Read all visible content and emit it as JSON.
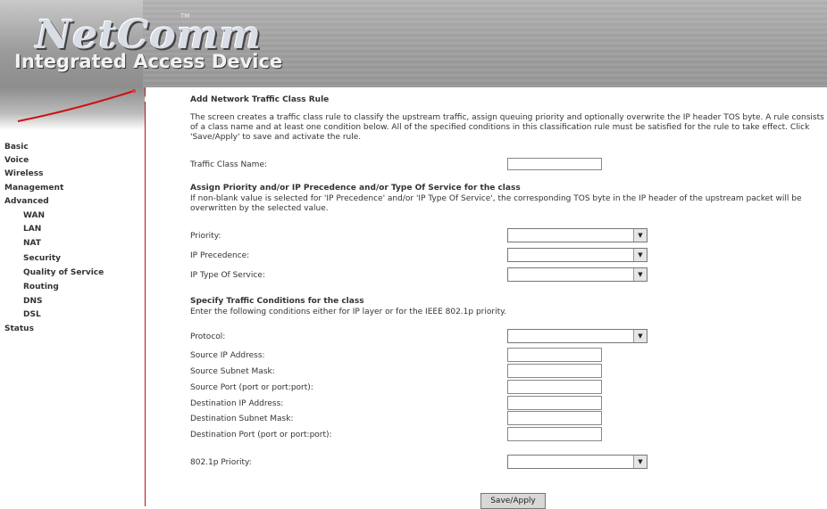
{
  "header": {
    "logo": "NetComm",
    "trademark": "TM",
    "product": "Integrated Access Device"
  },
  "sidebar": {
    "items": [
      "Basic",
      "Voice",
      "Wireless",
      "Management",
      "Advanced"
    ],
    "advanced_sub": [
      "WAN",
      "LAN",
      "NAT",
      "Security",
      "Quality of Service",
      "Routing",
      "DNS",
      "DSL"
    ],
    "status": "Status"
  },
  "page": {
    "title": "Add Network Traffic Class Rule",
    "description": "The screen creates a traffic class rule to classify the upstream traffic, assign queuing priority and optionally overwrite the IP header TOS byte. A rule consists of a class name and at least one condition below. All of the specified conditions in this classification rule must be satisfied for the rule to take effect. Click 'Save/Apply' to save and activate the rule.",
    "class_name_label": "Traffic Class Name:",
    "assign_heading": "Assign Priority and/or IP Precedence and/or Type Of Service for the class",
    "assign_note": "If non-blank value is selected for 'IP Precedence' and/or 'IP Type Of Service', the corresponding TOS byte in the IP header of the upstream packet will be overwritten by the selected value.",
    "priority_label": "Priority:",
    "precedence_label": "IP Precedence:",
    "tos_label": "IP Type Of Service:",
    "conditions_heading": "Specify Traffic Conditions for the class",
    "conditions_note": "Enter the following conditions either for IP layer or for the IEEE 802.1p priority.",
    "protocol_label": "Protocol:",
    "src_ip_label": "Source IP Address:",
    "src_mask_label": "Source Subnet Mask:",
    "src_port_label": "Source Port (port or port:port):",
    "dst_ip_label": "Destination IP Address:",
    "dst_mask_label": "Destination Subnet Mask:",
    "dst_port_label": "Destination Port (port or port:port):",
    "dot1p_label": "802.1p Priority:",
    "save_label": "Save/Apply"
  }
}
